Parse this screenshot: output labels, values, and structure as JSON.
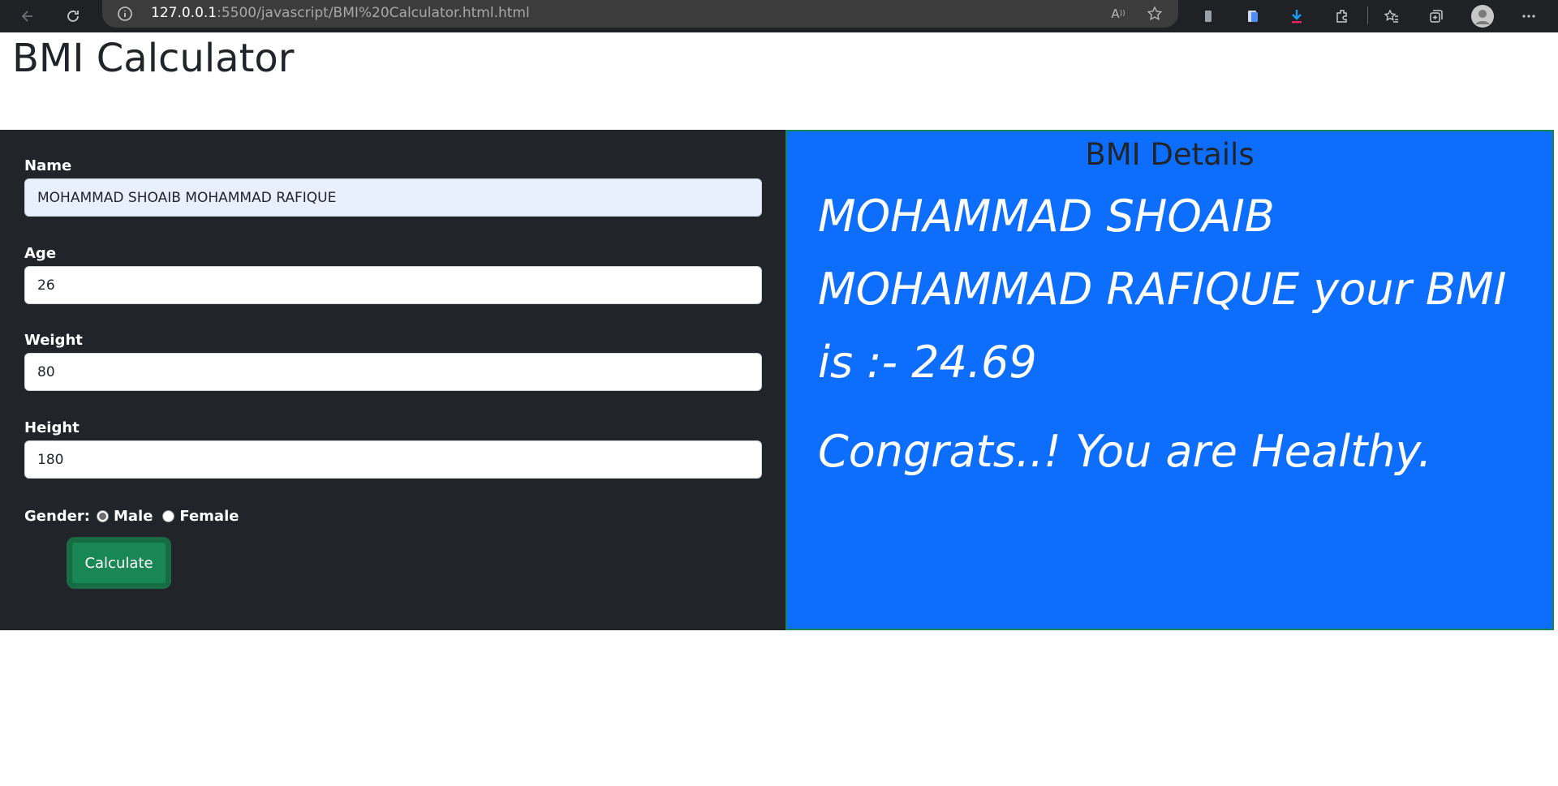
{
  "browser": {
    "url_host": "127.0.0.1",
    "url_rest": ":5500/javascript/BMI%20Calculator.html.html"
  },
  "page": {
    "title": "BMI Calculator"
  },
  "form": {
    "name_label": "Name",
    "name_value": "MOHAMMAD SHOAIB MOHAMMAD RAFIQUE",
    "age_label": "Age",
    "age_value": "26",
    "weight_label": "Weight",
    "weight_value": "80",
    "height_label": "Height",
    "height_value": "180",
    "gender_label": "Gender:",
    "gender_options": [
      "Male",
      "Female"
    ],
    "gender_selected": "Male",
    "calculate_label": "Calculate"
  },
  "details": {
    "title": "BMI Details",
    "result_text": "MOHAMMAD SHOAIB MOHAMMAD RAFIQUE your BMI is :- 24.69",
    "message": "Congrats..! You are Healthy."
  },
  "colors": {
    "form_bg": "#212529",
    "details_bg": "#0d6efd",
    "button_bg": "#198754"
  }
}
